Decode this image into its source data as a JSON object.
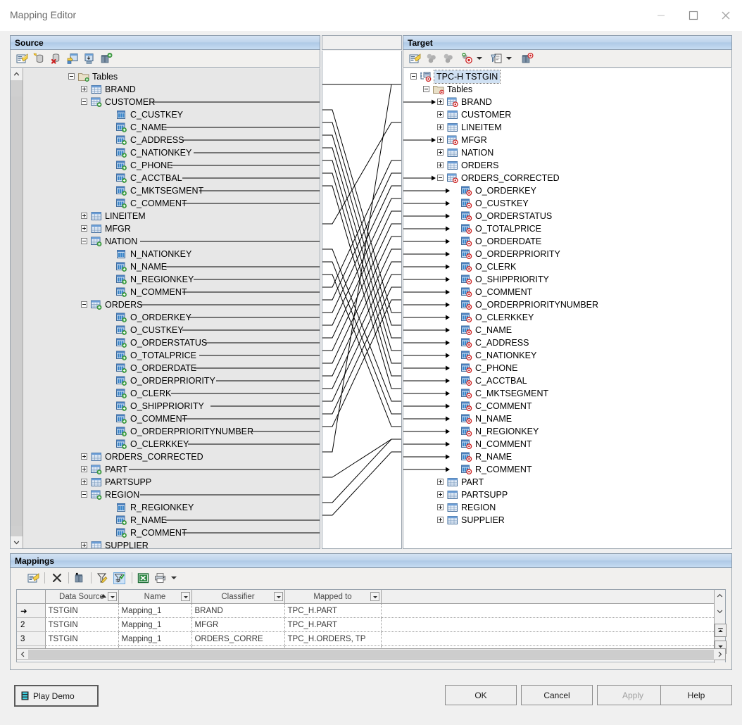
{
  "window": {
    "title": "Mapping Editor",
    "minimize_icon": "minimize-icon",
    "maximize_icon": "maximize-icon",
    "close_icon": "close-icon"
  },
  "source": {
    "header": "Source",
    "toolbar": [
      {
        "name": "properties-icon"
      },
      {
        "name": "new-database-icon"
      },
      {
        "name": "delete-database-icon"
      },
      {
        "name": "add-schema-icon"
      },
      {
        "name": "import-icon"
      },
      {
        "name": "find-add-icon"
      }
    ],
    "tree": [
      {
        "label": "Tables",
        "depth": 1,
        "toggle": "minus",
        "icon": "folder-source-icon",
        "line": false
      },
      {
        "label": "BRAND",
        "depth": 2,
        "toggle": "plus",
        "icon": "table-icon",
        "line": false
      },
      {
        "label": "CUSTOMER",
        "depth": 2,
        "toggle": "minus",
        "icon": "table-source-icon",
        "line": true
      },
      {
        "label": "C_CUSTKEY",
        "depth": 3,
        "toggle": "none",
        "icon": "column-key-icon",
        "line": false
      },
      {
        "label": "C_NAME",
        "depth": 3,
        "toggle": "none",
        "icon": "column-source-icon",
        "line": true
      },
      {
        "label": "C_ADDRESS",
        "depth": 3,
        "toggle": "none",
        "icon": "column-source-icon",
        "line": true
      },
      {
        "label": "C_NATIONKEY",
        "depth": 3,
        "toggle": "none",
        "icon": "column-source-icon",
        "line": true
      },
      {
        "label": "C_PHONE",
        "depth": 3,
        "toggle": "none",
        "icon": "column-source-icon",
        "line": true
      },
      {
        "label": "C_ACCTBAL",
        "depth": 3,
        "toggle": "none",
        "icon": "column-source-icon",
        "line": true
      },
      {
        "label": "C_MKTSEGMENT",
        "depth": 3,
        "toggle": "none",
        "icon": "column-source-icon",
        "line": true
      },
      {
        "label": "C_COMMENT",
        "depth": 3,
        "toggle": "none",
        "icon": "column-source-icon",
        "line": true
      },
      {
        "label": "LINEITEM",
        "depth": 2,
        "toggle": "plus",
        "icon": "table-icon",
        "line": false
      },
      {
        "label": "MFGR",
        "depth": 2,
        "toggle": "plus",
        "icon": "table-icon",
        "line": false
      },
      {
        "label": "NATION",
        "depth": 2,
        "toggle": "minus",
        "icon": "table-source-icon",
        "line": true
      },
      {
        "label": "N_NATIONKEY",
        "depth": 3,
        "toggle": "none",
        "icon": "column-key-icon",
        "line": false
      },
      {
        "label": "N_NAME",
        "depth": 3,
        "toggle": "none",
        "icon": "column-source-icon",
        "line": true
      },
      {
        "label": "N_REGIONKEY",
        "depth": 3,
        "toggle": "none",
        "icon": "column-source-icon",
        "line": true
      },
      {
        "label": "N_COMMENT",
        "depth": 3,
        "toggle": "none",
        "icon": "column-source-icon",
        "line": true
      },
      {
        "label": "ORDERS",
        "depth": 2,
        "toggle": "minus",
        "icon": "table-source-icon",
        "line": true
      },
      {
        "label": "O_ORDERKEY",
        "depth": 3,
        "toggle": "none",
        "icon": "column-source-icon",
        "line": true
      },
      {
        "label": "O_CUSTKEY",
        "depth": 3,
        "toggle": "none",
        "icon": "column-source-icon",
        "line": true
      },
      {
        "label": "O_ORDERSTATUS",
        "depth": 3,
        "toggle": "none",
        "icon": "column-source-icon",
        "line": true
      },
      {
        "label": "O_TOTALPRICE",
        "depth": 3,
        "toggle": "none",
        "icon": "column-source-icon",
        "line": true
      },
      {
        "label": "O_ORDERDATE",
        "depth": 3,
        "toggle": "none",
        "icon": "column-source-icon",
        "line": true
      },
      {
        "label": "O_ORDERPRIORITY",
        "depth": 3,
        "toggle": "none",
        "icon": "column-source-icon",
        "line": true
      },
      {
        "label": "O_CLERK",
        "depth": 3,
        "toggle": "none",
        "icon": "column-source-icon",
        "line": true
      },
      {
        "label": "O_SHIPPRIORITY",
        "depth": 3,
        "toggle": "none",
        "icon": "column-source-icon",
        "line": true
      },
      {
        "label": "O_COMMENT",
        "depth": 3,
        "toggle": "none",
        "icon": "column-source-icon",
        "line": true
      },
      {
        "label": "O_ORDERPRIORITYNUMBER",
        "depth": 3,
        "toggle": "none",
        "icon": "column-source-icon",
        "line": true
      },
      {
        "label": "O_CLERKKEY",
        "depth": 3,
        "toggle": "none",
        "icon": "column-source-icon",
        "line": true
      },
      {
        "label": "ORDERS_CORRECTED",
        "depth": 2,
        "toggle": "plus",
        "icon": "table-icon",
        "line": false
      },
      {
        "label": "PART",
        "depth": 2,
        "toggle": "plus",
        "icon": "table-source-icon",
        "line": true
      },
      {
        "label": "PARTSUPP",
        "depth": 2,
        "toggle": "plus",
        "icon": "table-icon",
        "line": false
      },
      {
        "label": "REGION",
        "depth": 2,
        "toggle": "minus",
        "icon": "table-source-icon",
        "line": true
      },
      {
        "label": "R_REGIONKEY",
        "depth": 3,
        "toggle": "none",
        "icon": "column-key-icon",
        "line": false
      },
      {
        "label": "R_NAME",
        "depth": 3,
        "toggle": "none",
        "icon": "column-source-icon",
        "line": true
      },
      {
        "label": "R_COMMENT",
        "depth": 3,
        "toggle": "none",
        "icon": "column-source-icon",
        "line": true
      },
      {
        "label": "SUPPLIER",
        "depth": 2,
        "toggle": "plus",
        "icon": "table-icon",
        "line": false
      }
    ]
  },
  "middle": {
    "header": ""
  },
  "target": {
    "header": "Target",
    "toolbar": [
      {
        "name": "properties-icon"
      },
      {
        "name": "merge-disabled-icon"
      },
      {
        "name": "split-disabled-icon"
      },
      {
        "name": "add-target-icon"
      },
      {
        "name": "target-dropdown-arrow"
      },
      {
        "name": "generate-icon"
      },
      {
        "name": "generate-dropdown-arrow"
      },
      {
        "name": "find-target-icon"
      }
    ],
    "tree": [
      {
        "label": "TPC-H TSTGIN",
        "depth": 0,
        "toggle": "minus",
        "icon": "datasource-target-icon",
        "arrow": false,
        "selected": true
      },
      {
        "label": "Tables",
        "depth": 1,
        "toggle": "minus",
        "icon": "folder-target-icon",
        "arrow": false
      },
      {
        "label": "BRAND",
        "depth": 2,
        "toggle": "plus",
        "icon": "table-target-icon",
        "arrow": true
      },
      {
        "label": "CUSTOMER",
        "depth": 2,
        "toggle": "plus",
        "icon": "table-icon",
        "arrow": false
      },
      {
        "label": "LINEITEM",
        "depth": 2,
        "toggle": "plus",
        "icon": "table-icon",
        "arrow": false
      },
      {
        "label": "MFGR",
        "depth": 2,
        "toggle": "plus",
        "icon": "table-target-icon",
        "arrow": true
      },
      {
        "label": "NATION",
        "depth": 2,
        "toggle": "plus",
        "icon": "table-icon",
        "arrow": false
      },
      {
        "label": "ORDERS",
        "depth": 2,
        "toggle": "plus",
        "icon": "table-icon",
        "arrow": false
      },
      {
        "label": "ORDERS_CORRECTED",
        "depth": 2,
        "toggle": "minus",
        "icon": "table-target-icon",
        "arrow": true
      },
      {
        "label": "O_ORDERKEY",
        "depth": 3,
        "toggle": "none",
        "icon": "column-target-icon",
        "arrow": true
      },
      {
        "label": "O_CUSTKEY",
        "depth": 3,
        "toggle": "none",
        "icon": "column-target-icon",
        "arrow": true
      },
      {
        "label": "O_ORDERSTATUS",
        "depth": 3,
        "toggle": "none",
        "icon": "column-target-icon",
        "arrow": true
      },
      {
        "label": "O_TOTALPRICE",
        "depth": 3,
        "toggle": "none",
        "icon": "column-target-icon",
        "arrow": true
      },
      {
        "label": "O_ORDERDATE",
        "depth": 3,
        "toggle": "none",
        "icon": "column-target-icon",
        "arrow": true
      },
      {
        "label": "O_ORDERPRIORITY",
        "depth": 3,
        "toggle": "none",
        "icon": "column-target-icon",
        "arrow": true
      },
      {
        "label": "O_CLERK",
        "depth": 3,
        "toggle": "none",
        "icon": "column-target-icon",
        "arrow": true
      },
      {
        "label": "O_SHIPPRIORITY",
        "depth": 3,
        "toggle": "none",
        "icon": "column-target-icon",
        "arrow": true
      },
      {
        "label": "O_COMMENT",
        "depth": 3,
        "toggle": "none",
        "icon": "column-target-icon",
        "arrow": true
      },
      {
        "label": "O_ORDERPRIORITYNUMBER",
        "depth": 3,
        "toggle": "none",
        "icon": "column-target-icon",
        "arrow": true
      },
      {
        "label": "O_CLERKKEY",
        "depth": 3,
        "toggle": "none",
        "icon": "column-target-icon",
        "arrow": true
      },
      {
        "label": "C_NAME",
        "depth": 3,
        "toggle": "none",
        "icon": "column-target-icon",
        "arrow": true
      },
      {
        "label": "C_ADDRESS",
        "depth": 3,
        "toggle": "none",
        "icon": "column-target-icon",
        "arrow": true
      },
      {
        "label": "C_NATIONKEY",
        "depth": 3,
        "toggle": "none",
        "icon": "column-target-icon",
        "arrow": true
      },
      {
        "label": "C_PHONE",
        "depth": 3,
        "toggle": "none",
        "icon": "column-target-icon",
        "arrow": true
      },
      {
        "label": "C_ACCTBAL",
        "depth": 3,
        "toggle": "none",
        "icon": "column-target-icon",
        "arrow": true
      },
      {
        "label": "C_MKTSEGMENT",
        "depth": 3,
        "toggle": "none",
        "icon": "column-target-icon",
        "arrow": true
      },
      {
        "label": "C_COMMENT",
        "depth": 3,
        "toggle": "none",
        "icon": "column-target-icon",
        "arrow": true
      },
      {
        "label": "N_NAME",
        "depth": 3,
        "toggle": "none",
        "icon": "column-target-icon",
        "arrow": true
      },
      {
        "label": "N_REGIONKEY",
        "depth": 3,
        "toggle": "none",
        "icon": "column-target-icon",
        "arrow": true
      },
      {
        "label": "N_COMMENT",
        "depth": 3,
        "toggle": "none",
        "icon": "column-target-icon",
        "arrow": true
      },
      {
        "label": "R_NAME",
        "depth": 3,
        "toggle": "none",
        "icon": "column-target-icon",
        "arrow": true
      },
      {
        "label": "R_COMMENT",
        "depth": 3,
        "toggle": "none",
        "icon": "column-target-icon",
        "arrow": true
      },
      {
        "label": "PART",
        "depth": 2,
        "toggle": "plus",
        "icon": "table-icon",
        "arrow": false
      },
      {
        "label": "PARTSUPP",
        "depth": 2,
        "toggle": "plus",
        "icon": "table-icon",
        "arrow": false
      },
      {
        "label": "REGION",
        "depth": 2,
        "toggle": "plus",
        "icon": "table-icon",
        "arrow": false
      },
      {
        "label": "SUPPLIER",
        "depth": 2,
        "toggle": "plus",
        "icon": "table-icon",
        "arrow": false
      }
    ]
  },
  "mappings": {
    "header": "Mappings",
    "toolbar": [
      {
        "name": "properties-icon"
      },
      {
        "name": "delete-icon"
      },
      {
        "name": "find-icon"
      },
      {
        "name": "edit-filter-icon"
      },
      {
        "name": "apply-filter-icon"
      },
      {
        "name": "export-excel-icon"
      },
      {
        "name": "print-icon"
      },
      {
        "name": "print-dropdown-arrow"
      }
    ],
    "columns": [
      "Data Source",
      "Name",
      "Classifier",
      "Mapped to"
    ],
    "sort_column": "Data Source",
    "sort_direction": "asc",
    "rows": [
      {
        "num": "➜",
        "data_source": "TSTGIN",
        "name": "Mapping_1",
        "classifier": "BRAND",
        "mapped_to": "TPC_H.PART",
        "current": true
      },
      {
        "num": "2",
        "data_source": "TSTGIN",
        "name": "Mapping_1",
        "classifier": "MFGR",
        "mapped_to": "TPC_H.PART",
        "current": false
      },
      {
        "num": "3",
        "data_source": "TSTGIN",
        "name": "Mapping_1",
        "classifier": "ORDERS_CORRE",
        "mapped_to": "TPC_H.ORDERS, TP",
        "current": false
      },
      {
        "num": "",
        "data_source": "",
        "name": "",
        "classifier": "",
        "mapped_to": "",
        "current": false
      }
    ]
  },
  "footer": {
    "play_demo": "Play Demo",
    "play_demo_icon": "film-icon",
    "ok": "OK",
    "cancel": "Cancel",
    "apply": "Apply",
    "apply_disabled": true,
    "help": "Help"
  },
  "colors": {
    "header_blue": "#aec9e6",
    "source_bg": "#e7e7e7",
    "target_bg": "#ffffff",
    "chrome": "#f0f0f0",
    "selection": "#cfe0f2"
  }
}
